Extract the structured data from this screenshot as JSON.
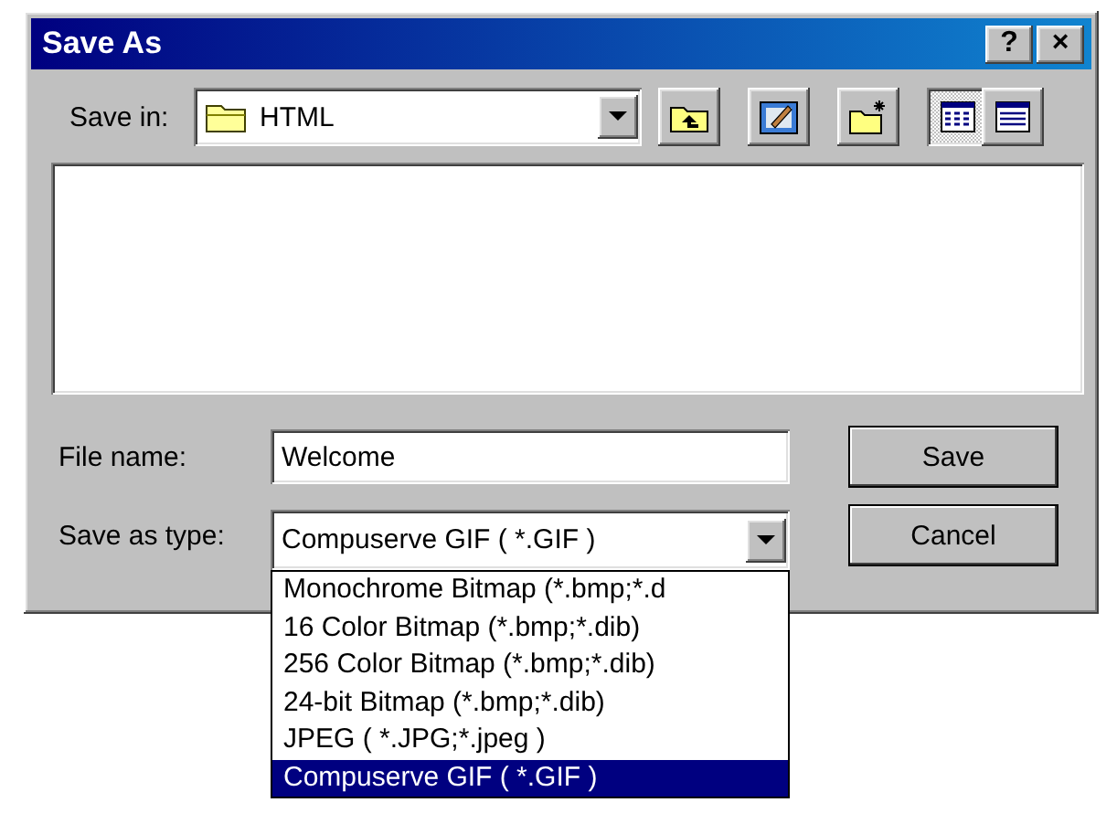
{
  "window": {
    "title": "Save As",
    "title_buttons": [
      "?",
      "×"
    ]
  },
  "save_in": {
    "label": "Save in:",
    "value": "HTML"
  },
  "toolbar": [
    {
      "kind": "up",
      "pressed": false
    },
    {
      "kind": "desktop",
      "pressed": false
    },
    {
      "kind": "new-folder",
      "pressed": false
    },
    {
      "kind": "list",
      "pressed": true
    },
    {
      "kind": "details",
      "pressed": false
    }
  ],
  "file_name": {
    "label": "File name:",
    "value": "Welcome"
  },
  "save_as_type": {
    "label": "Save as type:",
    "value": "Compuserve GIF ( *.GIF )",
    "options": [
      {
        "label": "Monochrome Bitmap (*.bmp;*.d",
        "selected": false
      },
      {
        "label": "16 Color Bitmap (*.bmp;*.dib)",
        "selected": false
      },
      {
        "label": "256 Color Bitmap (*.bmp;*.dib)",
        "selected": false
      },
      {
        "label": "24-bit Bitmap (*.bmp;*.dib)",
        "selected": false
      },
      {
        "label": "JPEG ( *.JPG;*.jpeg )",
        "selected": false
      },
      {
        "label": "Compuserve GIF ( *.GIF )",
        "selected": true
      }
    ]
  },
  "buttons": [
    "Save",
    "Cancel"
  ]
}
